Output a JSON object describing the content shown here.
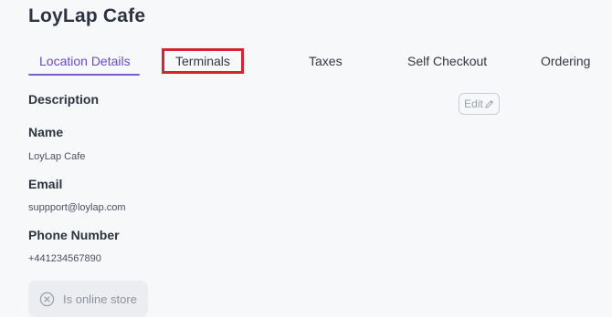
{
  "header": {
    "title": "LoyLap Cafe"
  },
  "tabs": [
    {
      "label": "Location Details",
      "active": true
    },
    {
      "label": "Terminals",
      "highlighted": true
    },
    {
      "label": "Taxes"
    },
    {
      "label": "Self Checkout"
    },
    {
      "label": "Ordering"
    }
  ],
  "details": {
    "description_label": "Description",
    "edit_label": "Edit",
    "name_label": "Name",
    "name_value": "LoyLap Cafe",
    "email_label": "Email",
    "email_value": "suppport@loylap.com",
    "phone_label": "Phone Number",
    "phone_value": "+441234567890",
    "online_store_label": "Is online store",
    "online_store_icon": "circle-x-icon"
  },
  "colors": {
    "accent": "#6a49c9",
    "highlight_box": "#d9222b"
  }
}
